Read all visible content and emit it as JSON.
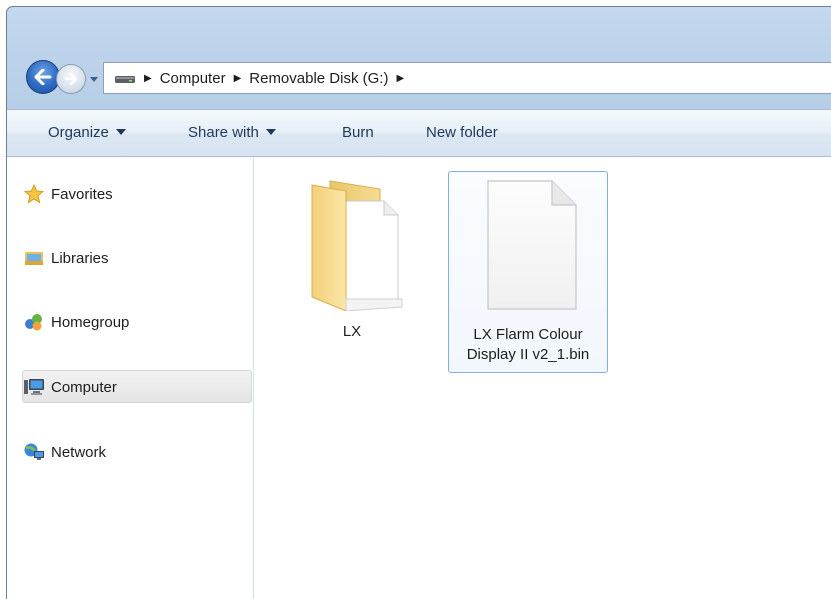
{
  "address": {
    "crumbs": [
      "Computer",
      "Removable Disk (G:)"
    ]
  },
  "toolbar": {
    "organize": "Organize",
    "share_with": "Share with",
    "burn": "Burn",
    "new_folder": "New folder"
  },
  "nav": {
    "favorites": "Favorites",
    "libraries": "Libraries",
    "homegroup": "Homegroup",
    "computer": "Computer",
    "network": "Network"
  },
  "files": [
    {
      "name": "LX",
      "type": "folder"
    },
    {
      "name_line1": "LX Flarm Colour",
      "name_line2": "Display II v2_1.bin",
      "type": "file",
      "selected": true
    }
  ],
  "colors": {
    "frame": "#bdd3ea",
    "selection_border": "#84acdd",
    "folder": "#f0d27a"
  }
}
